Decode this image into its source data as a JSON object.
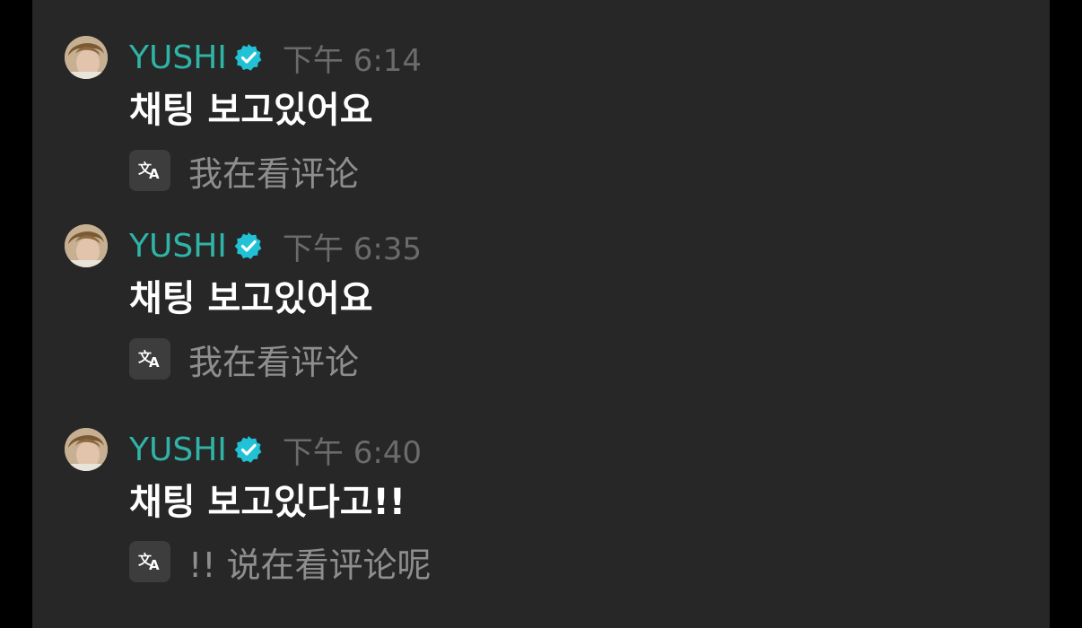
{
  "colors": {
    "panel_bg": "#272727",
    "outer_bg": "#000000",
    "username": "#2fb4a8",
    "verified": "#22c2d6",
    "timestamp": "#6b6b6b",
    "body_text": "#ffffff",
    "translation_text": "#8e8e8e"
  },
  "messages": [
    {
      "username": "YUSHI",
      "timestamp": "下午 6:14",
      "text": "채팅 보고있어요",
      "translation": "我在看评论"
    },
    {
      "username": "YUSHI",
      "timestamp": "下午 6:35",
      "text": "채팅 보고있어요",
      "translation": "我在看评论"
    },
    {
      "username": "YUSHI",
      "timestamp": "下午 6:40",
      "text": "채팅 보고있다고!!",
      "translation": "!!  说在看评论呢"
    }
  ],
  "icons": {
    "avatar": "avatar",
    "verified": "verified-badge-icon",
    "translate": "translate-icon"
  }
}
